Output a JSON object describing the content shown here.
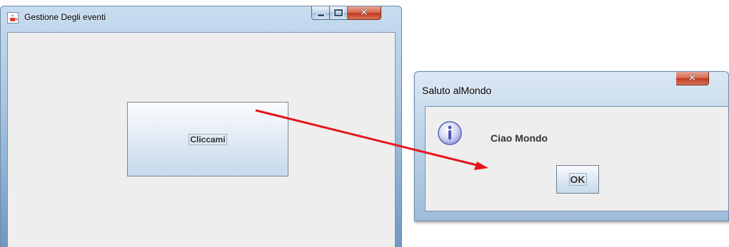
{
  "main_window": {
    "title": "Gestione Degli eventi",
    "button_label": "Cliccami"
  },
  "dialog": {
    "title": "Saluto alMondo",
    "message": "Ciao Mondo",
    "ok_label": "OK"
  },
  "colors": {
    "arrow": "#e8141b",
    "close_button": "#c3391c",
    "content_background": "#eeeeee"
  },
  "icons": {
    "app_icon": "java-cup-icon",
    "dialog_icon": "info-icon"
  }
}
